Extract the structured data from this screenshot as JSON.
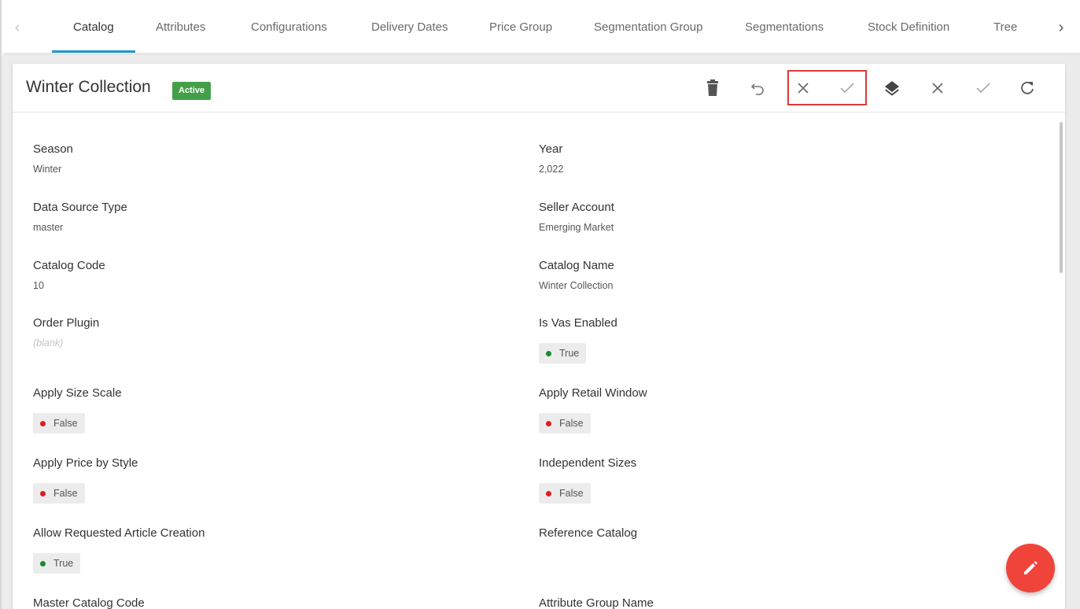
{
  "tabs": [
    {
      "label": "Catalog",
      "active": true
    },
    {
      "label": "Attributes"
    },
    {
      "label": "Configurations"
    },
    {
      "label": "Delivery Dates"
    },
    {
      "label": "Price Group"
    },
    {
      "label": "Segmentation Group"
    },
    {
      "label": "Segmentations"
    },
    {
      "label": "Stock Definition"
    },
    {
      "label": "Tree"
    }
  ],
  "header": {
    "title": "Winter Collection",
    "status": "Active"
  },
  "toolbar_icons": [
    "delete-icon",
    "undo-icon",
    "cancel-icon",
    "confirm-icon",
    "layers-icon",
    "close-icon",
    "check-icon",
    "refresh-icon"
  ],
  "fields": {
    "season": {
      "label": "Season",
      "value": "Winter"
    },
    "year": {
      "label": "Year",
      "value": "2,022"
    },
    "data_source_type": {
      "label": "Data Source Type",
      "value": "master"
    },
    "seller_account": {
      "label": "Seller Account",
      "value": "Emerging Market"
    },
    "catalog_code": {
      "label": "Catalog Code",
      "value": "10"
    },
    "catalog_name": {
      "label": "Catalog Name",
      "value": "Winter Collection"
    },
    "order_plugin": {
      "label": "Order Plugin",
      "value": "(blank)"
    },
    "is_vas_enabled": {
      "label": "Is Vas Enabled",
      "value": "True"
    },
    "apply_size_scale": {
      "label": "Apply Size Scale",
      "value": "False"
    },
    "apply_retail_window": {
      "label": "Apply Retail Window",
      "value": "False"
    },
    "apply_price_by_style": {
      "label": "Apply Price by Style",
      "value": "False"
    },
    "independent_sizes": {
      "label": "Independent Sizes",
      "value": "False"
    },
    "allow_requested_article_creation": {
      "label": "Allow Requested Article Creation",
      "value": "True"
    },
    "reference_catalog": {
      "label": "Reference Catalog"
    },
    "master_catalog_code": {
      "label": "Master Catalog Code"
    },
    "attribute_group_name": {
      "label": "Attribute Group Name"
    }
  },
  "colors": {
    "accent": "#2196c8",
    "active_badge": "#43a047",
    "true_dot": "#1b8a2f",
    "false_dot": "#e01e1e",
    "fab": "#f0443a",
    "highlight": "#d93a3a"
  }
}
